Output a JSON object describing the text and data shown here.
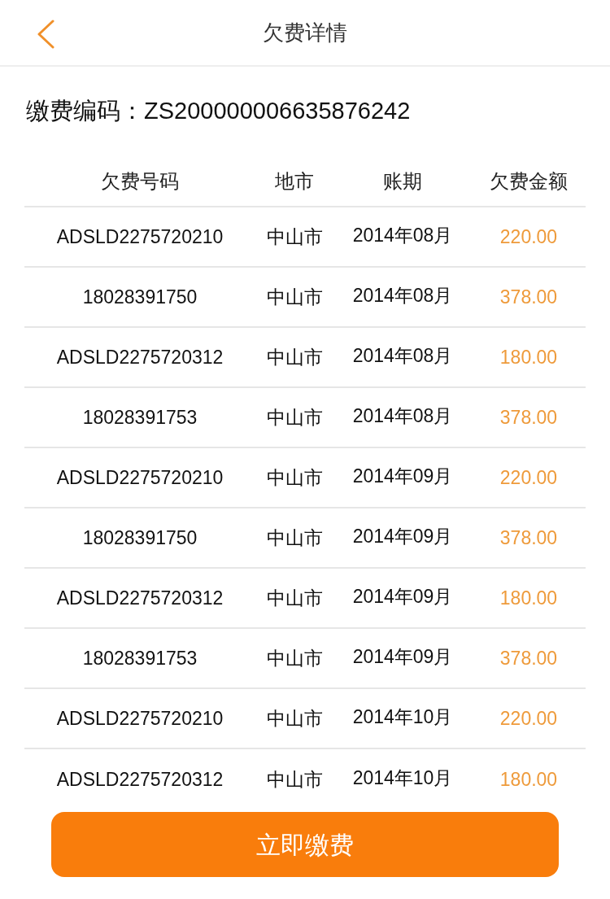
{
  "header": {
    "title": "欠费详情"
  },
  "payment_code": {
    "label": "缴费编码：",
    "value": "ZS200000006635876242"
  },
  "table": {
    "columns": [
      "欠费号码",
      "地市",
      "账期",
      "欠费金额"
    ],
    "rows": [
      {
        "number": "ADSLD2275720210",
        "city": "中山市",
        "period": "2014年08月",
        "amount": "220.00"
      },
      {
        "number": "18028391750",
        "city": "中山市",
        "period": "2014年08月",
        "amount": "378.00"
      },
      {
        "number": "ADSLD2275720312",
        "city": "中山市",
        "period": "2014年08月",
        "amount": "180.00"
      },
      {
        "number": "18028391753",
        "city": "中山市",
        "period": "2014年08月",
        "amount": "378.00"
      },
      {
        "number": "ADSLD2275720210",
        "city": "中山市",
        "period": "2014年09月",
        "amount": "220.00"
      },
      {
        "number": "18028391750",
        "city": "中山市",
        "period": "2014年09月",
        "amount": "378.00"
      },
      {
        "number": "ADSLD2275720312",
        "city": "中山市",
        "period": "2014年09月",
        "amount": "180.00"
      },
      {
        "number": "18028391753",
        "city": "中山市",
        "period": "2014年09月",
        "amount": "378.00"
      },
      {
        "number": "ADSLD2275720210",
        "city": "中山市",
        "period": "2014年10月",
        "amount": "220.00"
      },
      {
        "number": "ADSLD2275720312",
        "city": "中山市",
        "period": "2014年10月",
        "amount": "180.00"
      }
    ]
  },
  "pay_button": {
    "label": "立即缴费"
  }
}
